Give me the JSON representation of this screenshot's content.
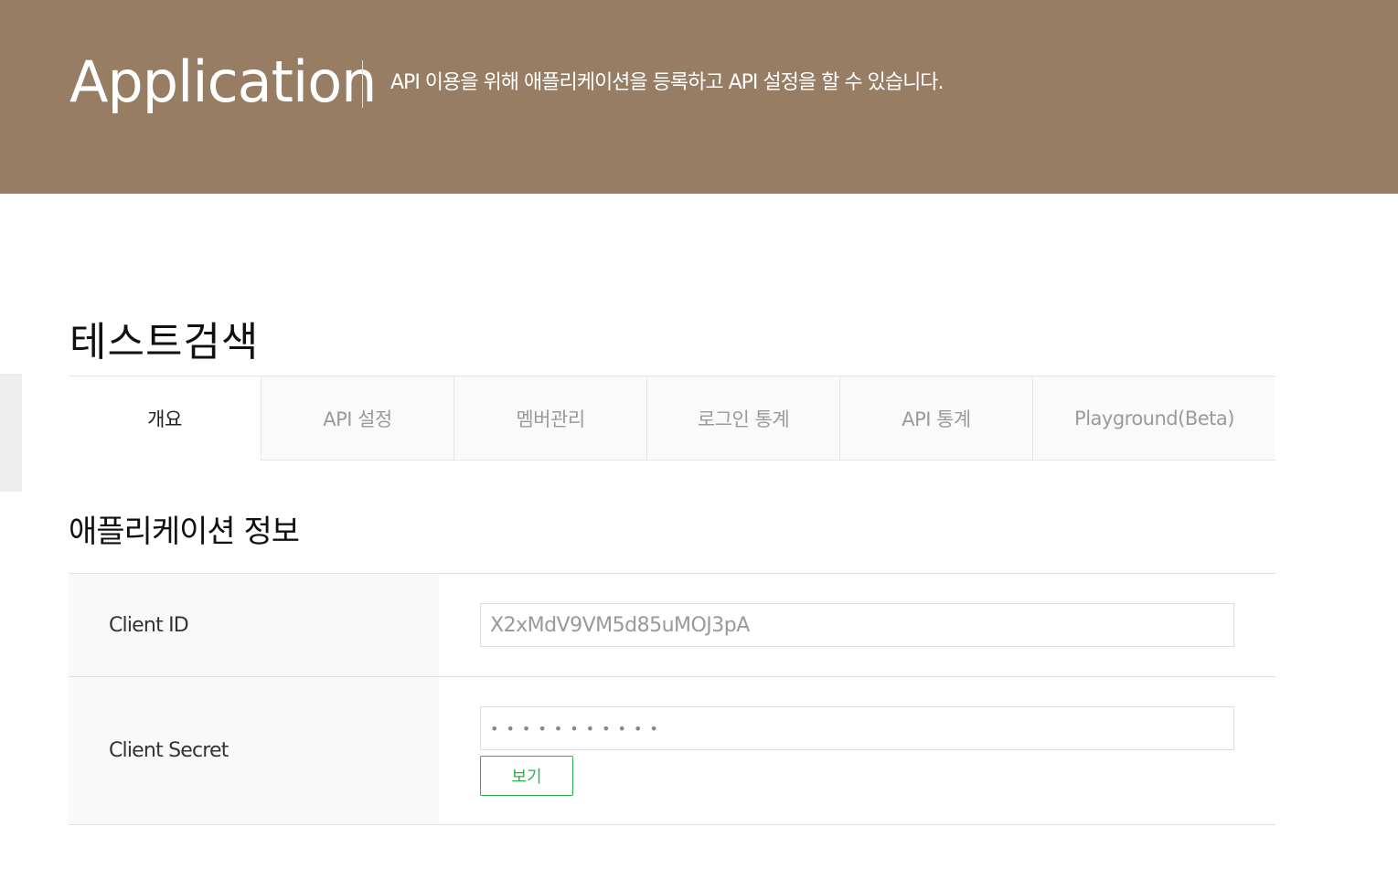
{
  "header": {
    "title": "Application",
    "description": "API 이용을 위해 애플리케이션을 등록하고 API 설정을 할 수 있습니다."
  },
  "app": {
    "name": "테스트검색"
  },
  "tabs": [
    {
      "label": "개요",
      "active": true
    },
    {
      "label": "API 설정",
      "active": false
    },
    {
      "label": "멤버관리",
      "active": false
    },
    {
      "label": "로그인 통계",
      "active": false
    },
    {
      "label": "API 통계",
      "active": false
    },
    {
      "label": "Playground(Beta)",
      "active": false
    }
  ],
  "section": {
    "title": "애플리케이션 정보"
  },
  "client_id": {
    "label": "Client ID",
    "value": "X2xMdV9VM5d85uMOJ3pA"
  },
  "client_secret": {
    "label": "Client Secret",
    "masked_value": "•••••••••••",
    "view_button": "보기"
  },
  "colors": {
    "header_bg": "#977d64",
    "accent_green": "#2bb24c"
  }
}
